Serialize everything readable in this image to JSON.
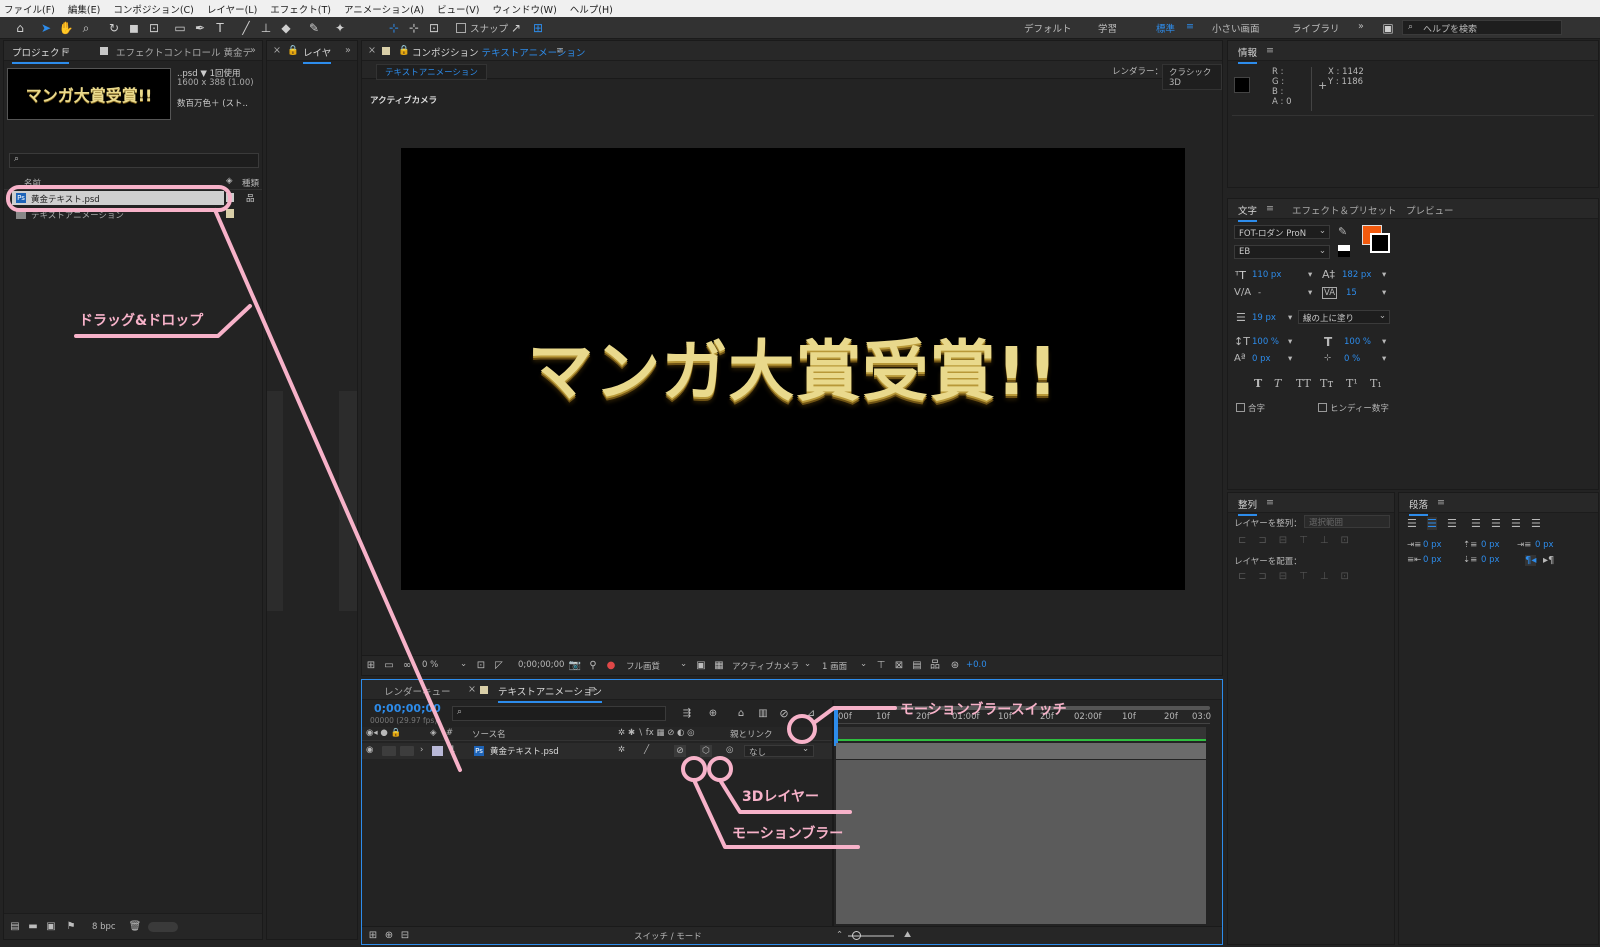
{
  "menu": [
    "ファイル(F)",
    "編集(E)",
    "コンポジション(C)",
    "レイヤー(L)",
    "エフェクト(T)",
    "アニメーション(A)",
    "ビュー(V)",
    "ウィンドウ(W)",
    "ヘルプ(H)"
  ],
  "toolbar": {
    "snap_label": "スナップ",
    "workspaces": [
      "デフォルト",
      "学習",
      "標準",
      "小さい画面",
      "ライブラリ"
    ],
    "active_workspace": "標準",
    "help_placeholder": "ヘルプを検索"
  },
  "project_panel": {
    "tab": "プロジェクト",
    "effect_tab": "エフェクトコントロール 黄金テ",
    "thumb_text": "マンガ大賞受賞!!",
    "file_line1": "..psd ▼  1回使用",
    "file_line2": "1600 x 388 (1.00)",
    "file_line3": "数百万色＋ (スト..",
    "col_name": "名前",
    "col_type": "種類",
    "items": [
      "黄金テキスト.psd",
      "テキストアニメーション"
    ],
    "bpc": "8 bpc"
  },
  "layer_panel": {
    "tab": "レイヤ"
  },
  "comp_panel": {
    "tab_prefix": "コンポジション",
    "tab_name": "テキストアニメーション",
    "subtab": "テキストアニメーション",
    "renderer_label": "レンダラー：",
    "renderer_value": "クラシック 3D",
    "camera_label": "アクティブカメラ",
    "title_text": "マンガ大賞受賞!!",
    "zoom": "0 %",
    "timecode": "0;00;00;00",
    "resolution": "フル画質",
    "view": "アクティブカメラ",
    "views": "1 画面",
    "exposure": "+0.0"
  },
  "timeline": {
    "render_tab": "レンダーキュー",
    "comp_tab": "テキストアニメーション",
    "timecode": "0;00;00;00",
    "fps": "00000 (29.97 fps)",
    "col_source": "ソース名",
    "col_parent": "親とリンク",
    "layer_num": "1",
    "layer_name": "黄金テキスト.psd",
    "parent_value": "なし",
    "ruler": [
      "00f",
      "10f",
      "20f",
      "01:00f",
      "10f",
      "20f",
      "02:00f",
      "10f",
      "20f",
      "03:0"
    ],
    "switch_mode": "スイッチ / モード"
  },
  "info_panel": {
    "tab": "情報",
    "r": "R :",
    "g": "G :",
    "b": "B :",
    "a": "A :  0",
    "x": "X : 1142",
    "y": "Y : 1186"
  },
  "character_panel": {
    "tab": "文字",
    "tab2": "エフェクト＆プリセット",
    "tab3": "プレビュー",
    "font": "FOT-ロダン ProN",
    "style": "EB",
    "size": "110 px",
    "leading": "182 px",
    "kerning": "-",
    "tracking": "15",
    "stroke": "19 px",
    "stroke_mode": "線の上に塗り",
    "v_scale": "100 %",
    "h_scale": "100 %",
    "baseline": "0 px",
    "tsume": "0 %",
    "ligature": "合字",
    "hindi": "ヒンディー数字",
    "fill_color": "#f25a0e"
  },
  "align_panel": {
    "tab": "整列",
    "align_to": "レイヤーを整列：",
    "align_target": "選択範囲",
    "distribute": "レイヤーを配置："
  },
  "paragraph_panel": {
    "tab": "段落",
    "v1": "0 px",
    "v2": "0 px",
    "v3": "0 px",
    "v4": "0 px",
    "v5": "0 px"
  },
  "annotations": {
    "drag_drop": "ドラッグ&ドロップ",
    "motion_blur_switch": "モーションブラースイッチ",
    "layer_3d": "3Dレイヤー",
    "motion_blur": "モーションブラー"
  },
  "colors": {
    "accent": "#2d8ceb",
    "annotation": "#f7b2c9",
    "gold_text": "#e9d98c"
  }
}
